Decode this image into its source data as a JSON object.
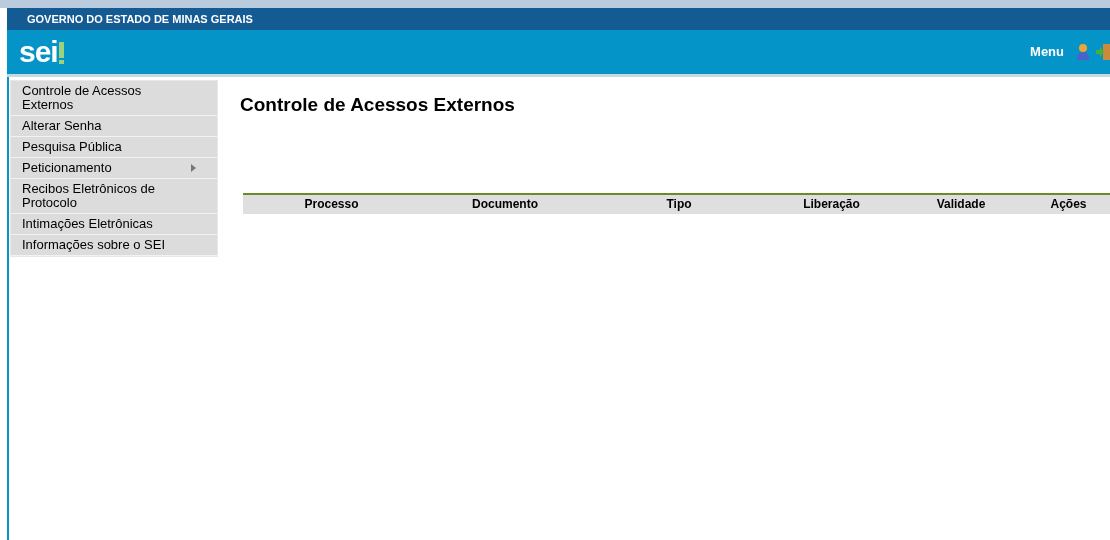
{
  "header": {
    "government": "GOVERNO DO ESTADO DE MINAS GERAIS",
    "logo": "sei",
    "menu_link": "Menu"
  },
  "sidebar": {
    "items": [
      {
        "label": "Controle de Acessos Externos",
        "kind": "link"
      },
      {
        "label": "Alterar Senha",
        "kind": "link"
      },
      {
        "label": "Pesquisa Pública",
        "kind": "link"
      },
      {
        "label": "Peticionamento",
        "kind": "submenu"
      },
      {
        "label": "Recibos Eletrônicos de Protocolo",
        "kind": "link"
      },
      {
        "label": "Intimações Eletrônicas",
        "kind": "link"
      },
      {
        "label": "Informações sobre o SEI",
        "kind": "link"
      }
    ]
  },
  "page_title": "Controle de Acessos Externos",
  "table": {
    "columns": [
      "Processo",
      "Documento",
      "Tipo",
      "Liberação",
      "Validade",
      "Ações"
    ]
  }
}
